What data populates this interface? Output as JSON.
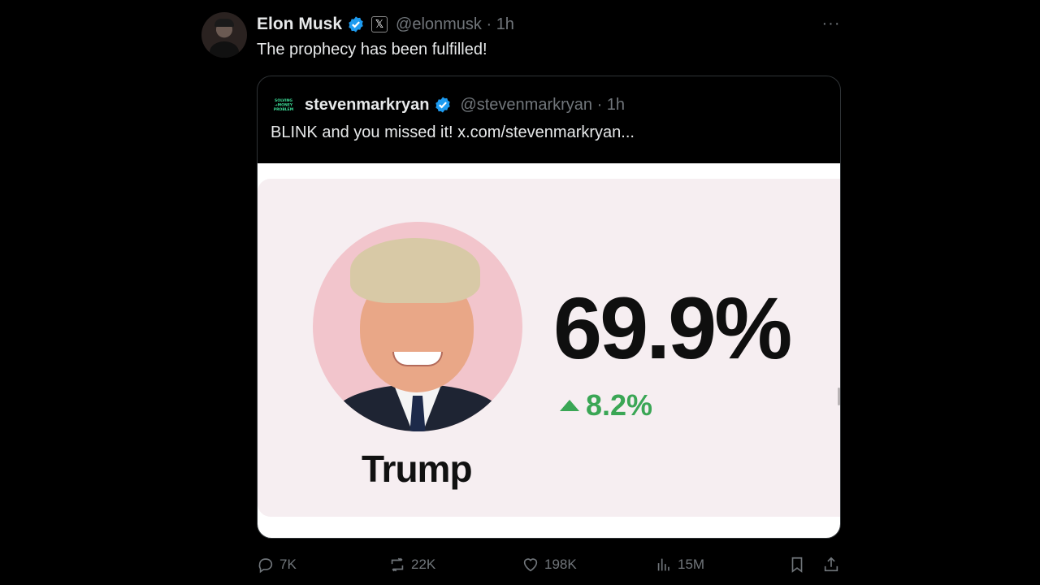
{
  "tweet": {
    "author_name": "Elon Musk",
    "affiliate_badge": "𝕏",
    "handle_time": "@elonmusk · 1h",
    "text": "The prophecy has been fulfilled!",
    "more": "···"
  },
  "quote": {
    "logo_text": "SOLVING MONEY PROBLEM",
    "author_name": "stevenmarkryan",
    "handle_time": "@stevenmarkryan · 1h",
    "text": "BLINK and you missed it!  x.com/stevenmarkryan..."
  },
  "media": {
    "candidate": "Trump",
    "percentage": "69.9%",
    "change": "8.2%",
    "accent": "#3aa655"
  },
  "actions": {
    "replies": "7K",
    "reposts": "22K",
    "likes": "198K",
    "views": "15M"
  }
}
